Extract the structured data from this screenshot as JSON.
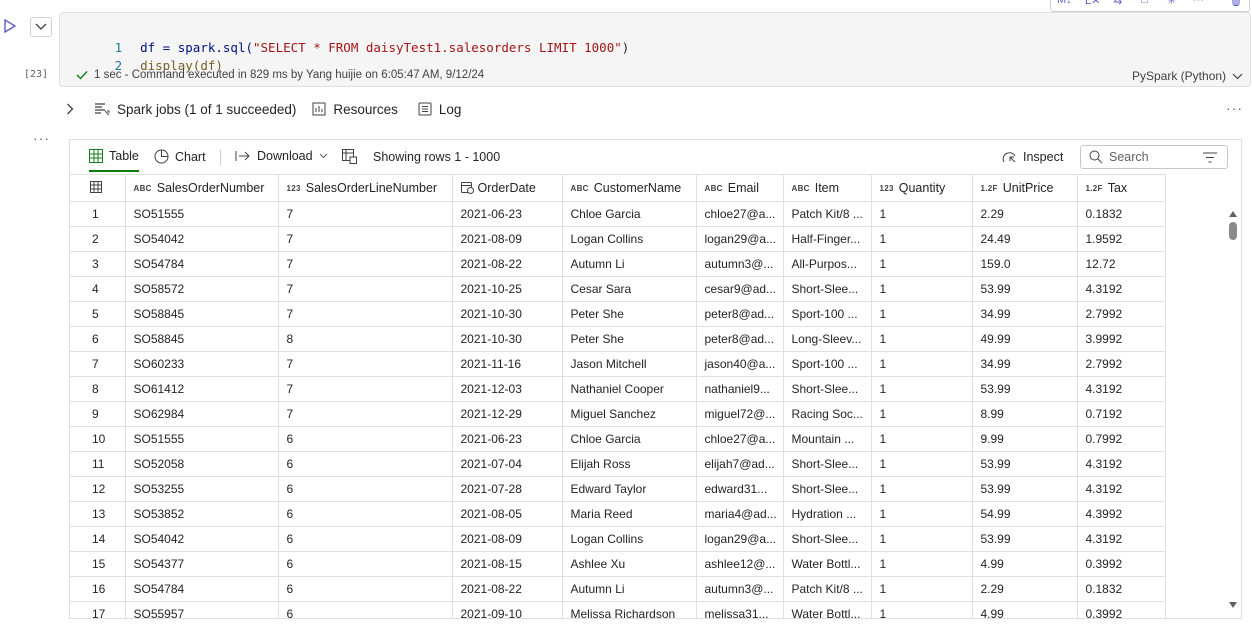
{
  "cell": {
    "exec_count": "[23]",
    "code_lines": [
      {
        "num": "1",
        "prefix": "df = spark.sql(",
        "string": "\"SELECT * FROM daisyTest1.salesorders LIMIT 1000\"",
        "suffix": ")"
      },
      {
        "num": "2",
        "prefix": "display(df)",
        "string": "",
        "suffix": ""
      }
    ],
    "status": "1 sec - Command executed in 829 ms by Yang huijie on 6:05:47 AM, 9/12/24",
    "language": "PySpark (Python)"
  },
  "output_toolbar": {
    "spark_jobs": "Spark jobs (1 of 1 succeeded)",
    "resources": "Resources",
    "log": "Log"
  },
  "table_toolbar": {
    "table": "Table",
    "chart": "Chart",
    "download": "Download",
    "rows_info": "Showing rows 1 - 1000",
    "inspect": "Inspect",
    "search_placeholder": "Search"
  },
  "columns": [
    {
      "type": "ABC",
      "name": "SalesOrderNumber"
    },
    {
      "type": "123",
      "name": "SalesOrderLineNumber"
    },
    {
      "type": "date",
      "name": "OrderDate"
    },
    {
      "type": "ABC",
      "name": "CustomerName"
    },
    {
      "type": "ABC",
      "name": "Email"
    },
    {
      "type": "ABC",
      "name": "Item"
    },
    {
      "type": "123",
      "name": "Quantity"
    },
    {
      "type": "1.2F",
      "name": "UnitPrice"
    },
    {
      "type": "1.2F",
      "name": "Tax"
    }
  ],
  "rows": [
    [
      "1",
      "SO51555",
      "7",
      "2021-06-23",
      "Chloe Garcia",
      "chloe27@a...",
      "Patch Kit/8 ...",
      "1",
      "2.29",
      "0.1832"
    ],
    [
      "2",
      "SO54042",
      "7",
      "2021-08-09",
      "Logan Collins",
      "logan29@a...",
      "Half-Finger...",
      "1",
      "24.49",
      "1.9592"
    ],
    [
      "3",
      "SO54784",
      "7",
      "2021-08-22",
      "Autumn Li",
      "autumn3@...",
      "All-Purpos...",
      "1",
      "159.0",
      "12.72"
    ],
    [
      "4",
      "SO58572",
      "7",
      "2021-10-25",
      "Cesar Sara",
      "cesar9@ad...",
      "Short-Slee...",
      "1",
      "53.99",
      "4.3192"
    ],
    [
      "5",
      "SO58845",
      "7",
      "2021-10-30",
      "Peter She",
      "peter8@ad...",
      "Sport-100 ...",
      "1",
      "34.99",
      "2.7992"
    ],
    [
      "6",
      "SO58845",
      "8",
      "2021-10-30",
      "Peter She",
      "peter8@ad...",
      "Long-Sleev...",
      "1",
      "49.99",
      "3.9992"
    ],
    [
      "7",
      "SO60233",
      "7",
      "2021-11-16",
      "Jason Mitchell",
      "jason40@a...",
      "Sport-100 ...",
      "1",
      "34.99",
      "2.7992"
    ],
    [
      "8",
      "SO61412",
      "7",
      "2021-12-03",
      "Nathaniel Cooper",
      "nathaniel9...",
      "Short-Slee...",
      "1",
      "53.99",
      "4.3192"
    ],
    [
      "9",
      "SO62984",
      "7",
      "2021-12-29",
      "Miguel Sanchez",
      "miguel72@...",
      "Racing Soc...",
      "1",
      "8.99",
      "0.7192"
    ],
    [
      "10",
      "SO51555",
      "6",
      "2021-06-23",
      "Chloe Garcia",
      "chloe27@a...",
      "Mountain ...",
      "1",
      "9.99",
      "0.7992"
    ],
    [
      "11",
      "SO52058",
      "6",
      "2021-07-04",
      "Elijah Ross",
      "elijah7@ad...",
      "Short-Slee...",
      "1",
      "53.99",
      "4.3192"
    ],
    [
      "12",
      "SO53255",
      "6",
      "2021-07-28",
      "Edward Taylor",
      "edward31...",
      "Short-Slee...",
      "1",
      "53.99",
      "4.3192"
    ],
    [
      "13",
      "SO53852",
      "6",
      "2021-08-05",
      "Maria Reed",
      "maria4@ad...",
      "Hydration ...",
      "1",
      "54.99",
      "4.3992"
    ],
    [
      "14",
      "SO54042",
      "6",
      "2021-08-09",
      "Logan Collins",
      "logan29@a...",
      "Short-Slee...",
      "1",
      "53.99",
      "4.3192"
    ],
    [
      "15",
      "SO54377",
      "6",
      "2021-08-15",
      "Ashlee Xu",
      "ashlee12@...",
      "Water Bottl...",
      "1",
      "4.99",
      "0.3992"
    ],
    [
      "16",
      "SO54784",
      "6",
      "2021-08-22",
      "Autumn Li",
      "autumn3@...",
      "Patch Kit/8 ...",
      "1",
      "2.29",
      "0.1832"
    ],
    [
      "17",
      "SO55957",
      "6",
      "2021-09-10",
      "Melissa Richardson",
      "melissa31...",
      "Water Bottl...",
      "1",
      "4.99",
      "0.3992"
    ]
  ]
}
